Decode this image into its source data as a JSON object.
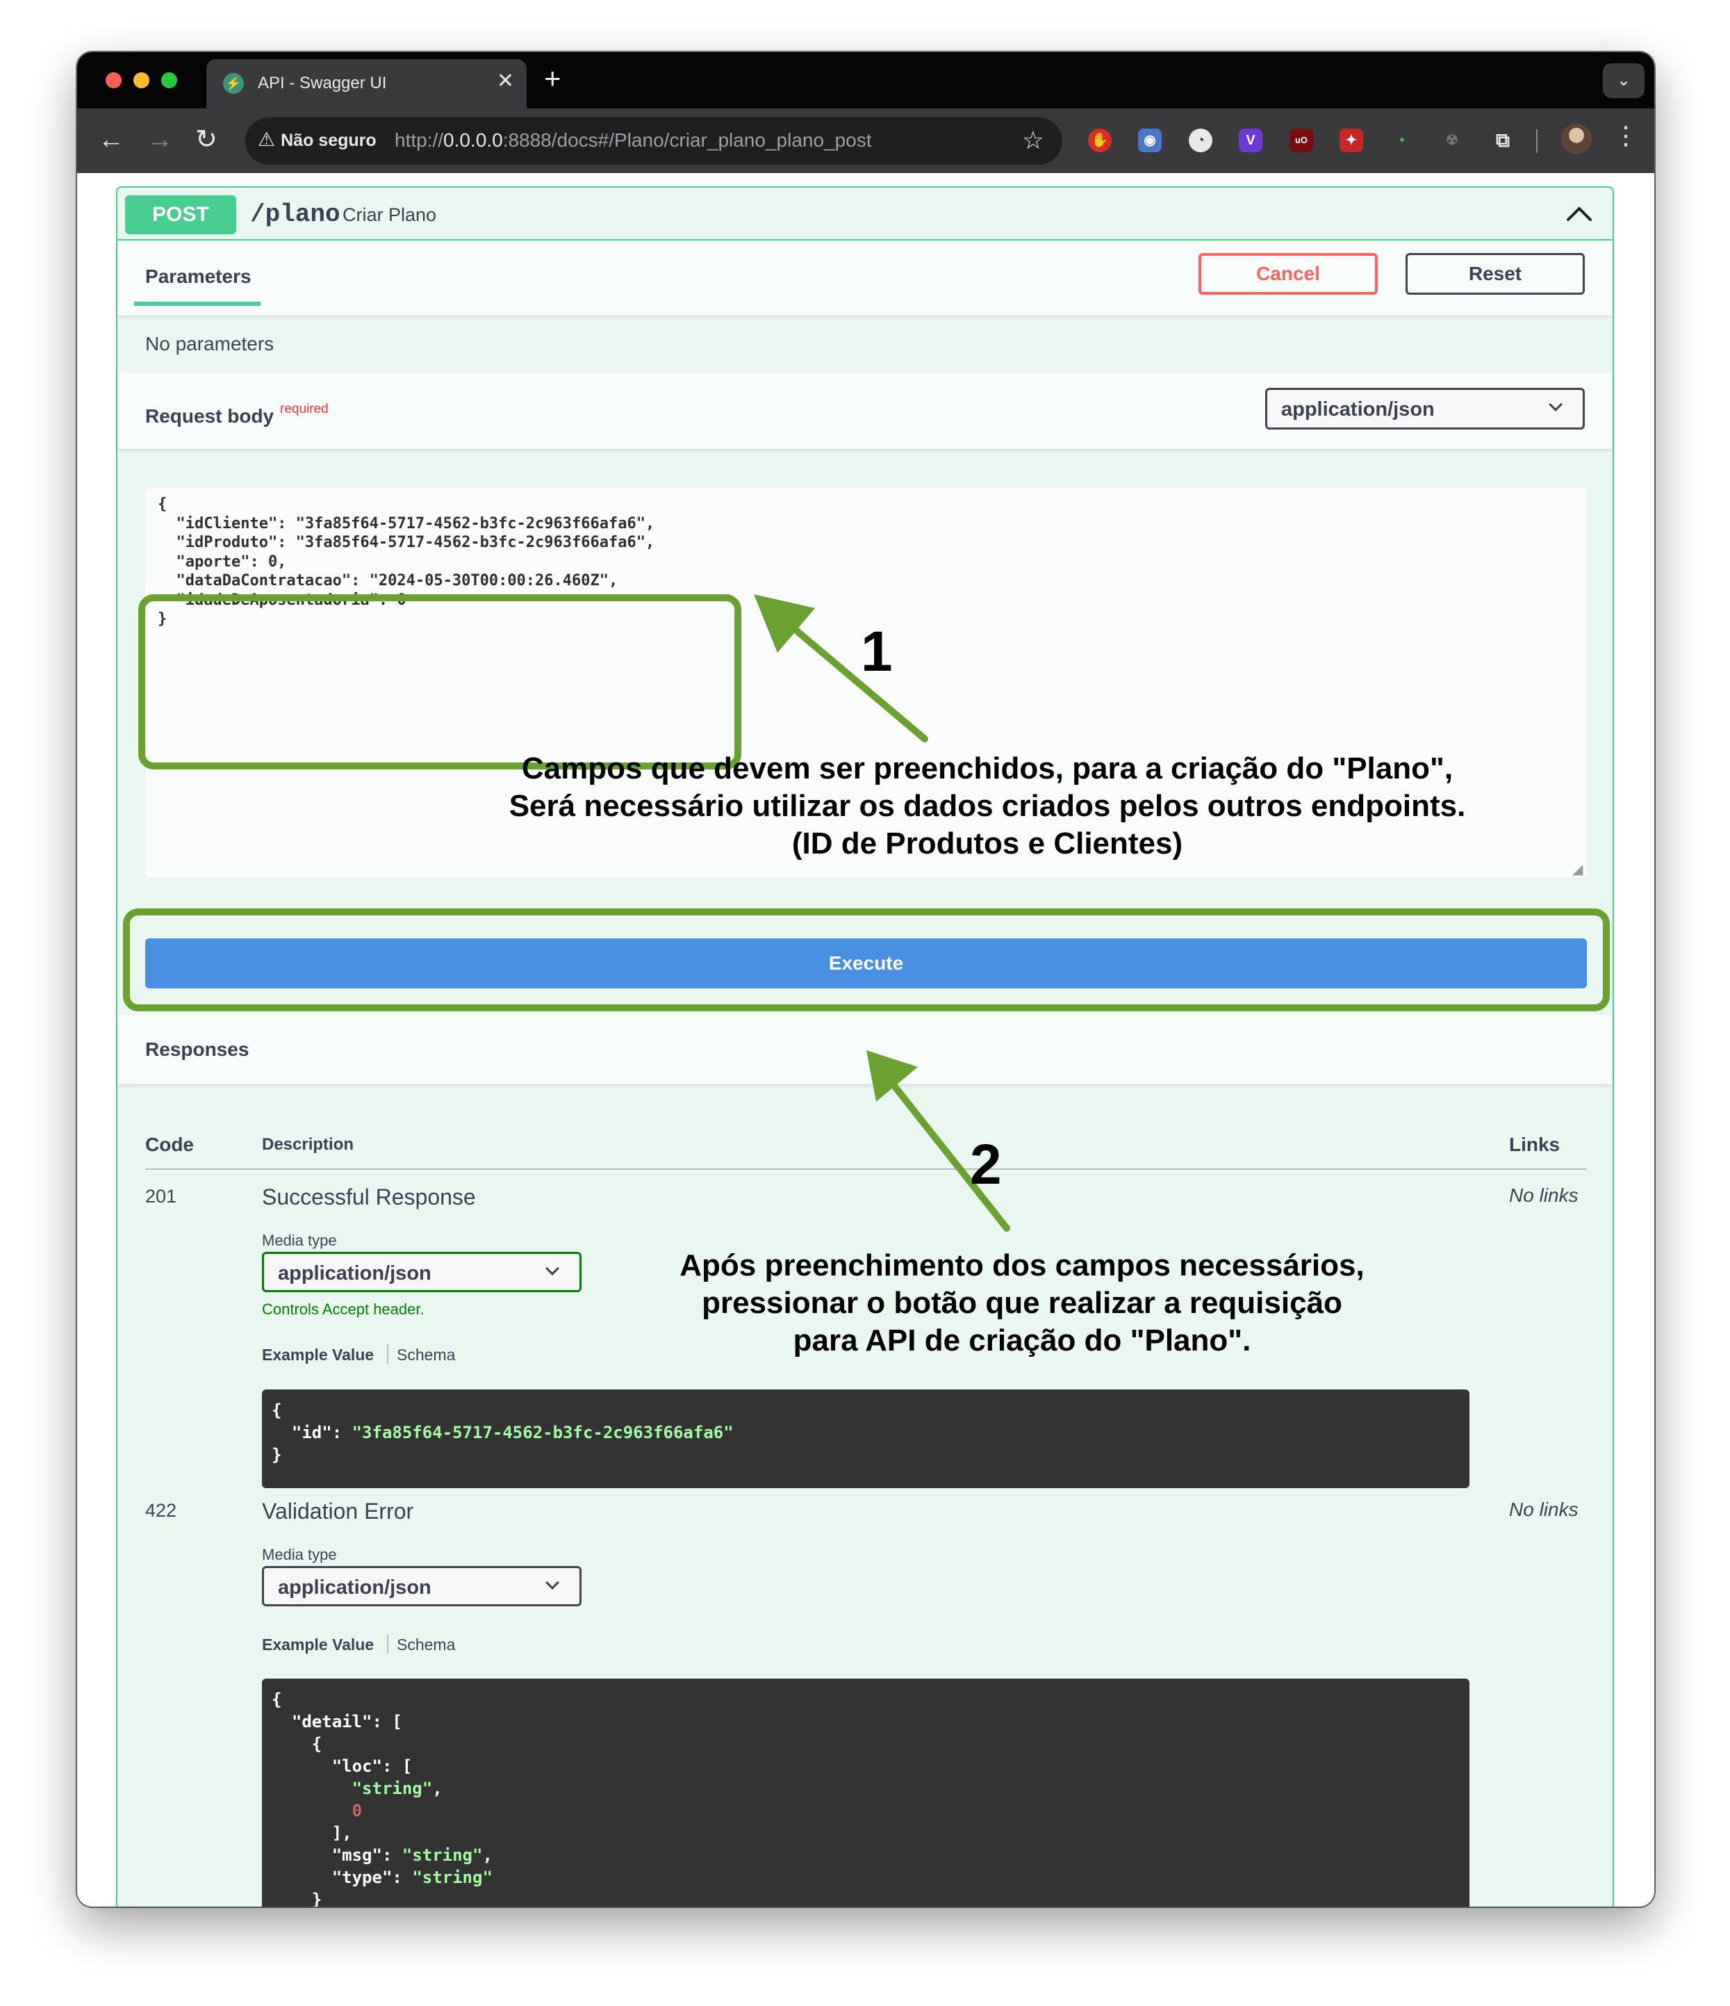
{
  "browser": {
    "tab_title": "API - Swagger UI",
    "tab_close": "✕",
    "new_tab": "+",
    "security_label": "Não seguro",
    "url_scheme": "http://",
    "url_host": "0.0.0.0",
    "url_rest": ":8888/docs#/Plano/criar_plano_plano_post"
  },
  "operation": {
    "method": "POST",
    "path": "/plano",
    "summary": "Criar Plano",
    "parameters_tab": "Parameters",
    "cancel_label": "Cancel",
    "reset_label": "Reset",
    "no_parameters": "No parameters",
    "request_body_label": "Request body",
    "required_label": "required",
    "content_type": "application/json",
    "request_body_json": "{\n  \"idCliente\": \"3fa85f64-5717-4562-b3fc-2c963f66afa6\",\n  \"idProduto\": \"3fa85f64-5717-4562-b3fc-2c963f66afa6\",\n  \"aporte\": 0,\n  \"dataDaContratacao\": \"2024-05-30T00:00:26.460Z\",\n  \"idadeDeAposentadoria\": 0\n}",
    "execute_label": "Execute"
  },
  "responses": {
    "title": "Responses",
    "columns": {
      "code": "Code",
      "description": "Description",
      "links": "Links"
    },
    "media_type_label": "Media type",
    "example_value_label": "Example Value",
    "schema_label": "Schema",
    "items": [
      {
        "code": "201",
        "description": "Successful Response",
        "media_type": "application/json",
        "controls_note": "Controls Accept header.",
        "links": "No links",
        "example": {
          "open": "{",
          "id_key": "\"id\"",
          "id_value": "\"3fa85f64-5717-4562-b3fc-2c963f66afa6\"",
          "close": "}"
        }
      },
      {
        "code": "422",
        "description": "Validation Error",
        "media_type": "application/json",
        "links": "No links",
        "example": {
          "l1": "{",
          "detail_key": "\"detail\"",
          "detail_open": ": [",
          "l3": "{",
          "loc_key": "\"loc\"",
          "loc_open": ": [",
          "loc_str": "\"string\"",
          "loc_num": "0",
          "loc_close": "],",
          "msg_key": "\"msg\"",
          "msg_val": "\"string\"",
          "type_key": "\"type\"",
          "type_val": "\"string\"",
          "l10": "}"
        }
      }
    ]
  },
  "annotations": {
    "marker1": "1",
    "note1": [
      "Campos que devem ser preenchidos, para a criação do \"Plano\",",
      "Será necessário utilizar os dados criados pelos outros endpoints.",
      "(ID de Produtos e Clientes)"
    ],
    "marker2": "2",
    "note2": [
      "Após preenchimento dos campos necessários,",
      "pressionar o botão que realizar a requisição",
      "para API de criação do \"Plano\"."
    ],
    "highlight_color": "#6aa131"
  },
  "colors": {
    "post_green": "#49cc90",
    "execute_blue": "#4990e2",
    "cancel_red": "#ff6060"
  }
}
